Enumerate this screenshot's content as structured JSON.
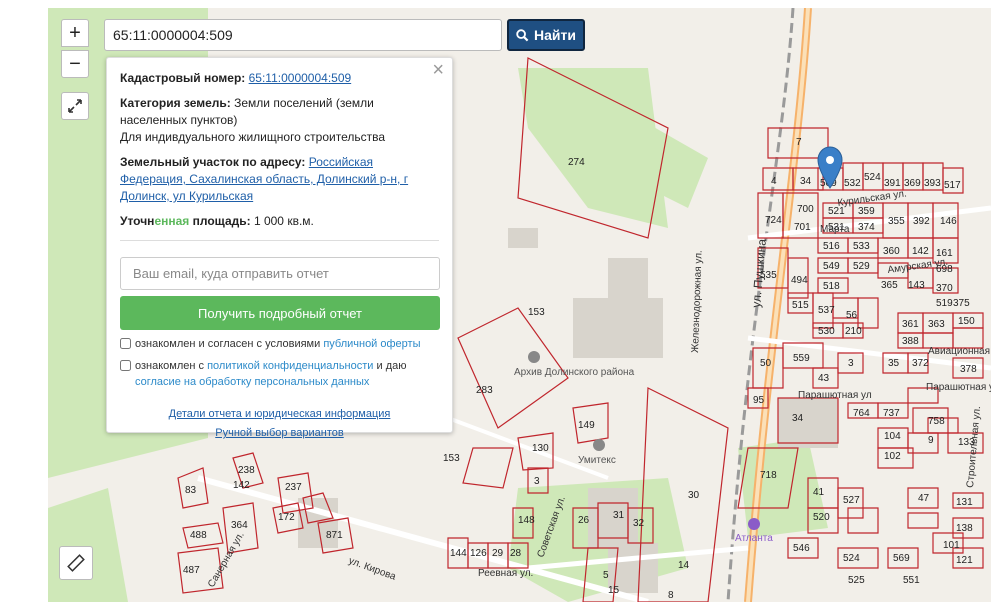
{
  "search": {
    "value": "65:11:0000004:509",
    "button_label": "Найти"
  },
  "controls": {
    "zoom_in": "+",
    "zoom_out": "−"
  },
  "panel": {
    "close": "×",
    "cadastral_label": "Кадастровый номер:",
    "cadastral_value": "65:11:0000004:509",
    "category_label": "Категория земель:",
    "category_value": "Земли поселений (земли населенных пунктов)",
    "usage": "Для индивдуального жилищного строительства",
    "address_label": "Земельный участок по адресу:",
    "address_value": "Российская Федерация, Сахалинская область, Долинский р-н, г Долинск, ул Курильская",
    "area_label_a": "Уточн",
    "area_label_b": "енная",
    "area_label_c": " площадь:",
    "area_value": "1 000 кв.м.",
    "email_placeholder": "Ваш email, куда отправить отчет",
    "report_button": "Получить подробный отчет",
    "check1_text": "ознакомлен и согласен с условиями ",
    "check1_link": "публичной оферты",
    "check2_text_a": "ознакомлен с ",
    "check2_link_a": "политикой конфиденциальности",
    "check2_text_b": " и даю ",
    "check2_link_b": "согласие на обработку персональных данных",
    "details_link": "Детали отчета и юридическая информация",
    "manual_link": "Ручной выбор вариантов"
  },
  "map": {
    "colors": {
      "parcel": "#c0262d",
      "green": "#cfe8b8",
      "road": "#f6b26b",
      "building": "#d8d4cc"
    },
    "streets": [
      "Железнодорожная ул.",
      "ул. Пушкина",
      "Курильская ул.",
      "Марта",
      "Амурская ул.",
      "Авиационная",
      "Парашютная ул.",
      "Парашютная ул",
      "ул. Кирова",
      "Советская ул.",
      "Реевная ул.",
      "Санерная ул.",
      "Строительная ул."
    ],
    "places": [
      "Архив Долинского района",
      "Умитекс",
      "Атланта"
    ],
    "parcels": [
      "274",
      "7",
      "4",
      "34",
      "509",
      "532",
      "524",
      "391",
      "369",
      "393",
      "517",
      "724",
      "700",
      "521",
      "359",
      "355",
      "392",
      "146",
      "701",
      "531",
      "374",
      "516",
      "533",
      "360",
      "142",
      "161",
      "535",
      "494",
      "549",
      "529",
      "698",
      "518",
      "365",
      "143",
      "370",
      "515",
      "537",
      "56",
      "519",
      "375",
      "530",
      "210",
      "361",
      "363",
      "388",
      "150",
      "153",
      "50",
      "559",
      "3",
      "35",
      "372",
      "43",
      "378",
      "95",
      "34",
      "764",
      "737",
      "758",
      "104",
      "9",
      "102",
      "133",
      "718",
      "283",
      "130",
      "149",
      "153",
      "3",
      "148",
      "26",
      "31",
      "32",
      "144",
      "126",
      "29",
      "28",
      "83",
      "238",
      "142",
      "237",
      "172",
      "871",
      "488",
      "364",
      "487",
      "41",
      "527",
      "520",
      "546",
      "569",
      "524",
      "525",
      "551",
      "47",
      "131",
      "138",
      "101",
      "121",
      "30",
      "14",
      "15",
      "8",
      "5"
    ]
  }
}
